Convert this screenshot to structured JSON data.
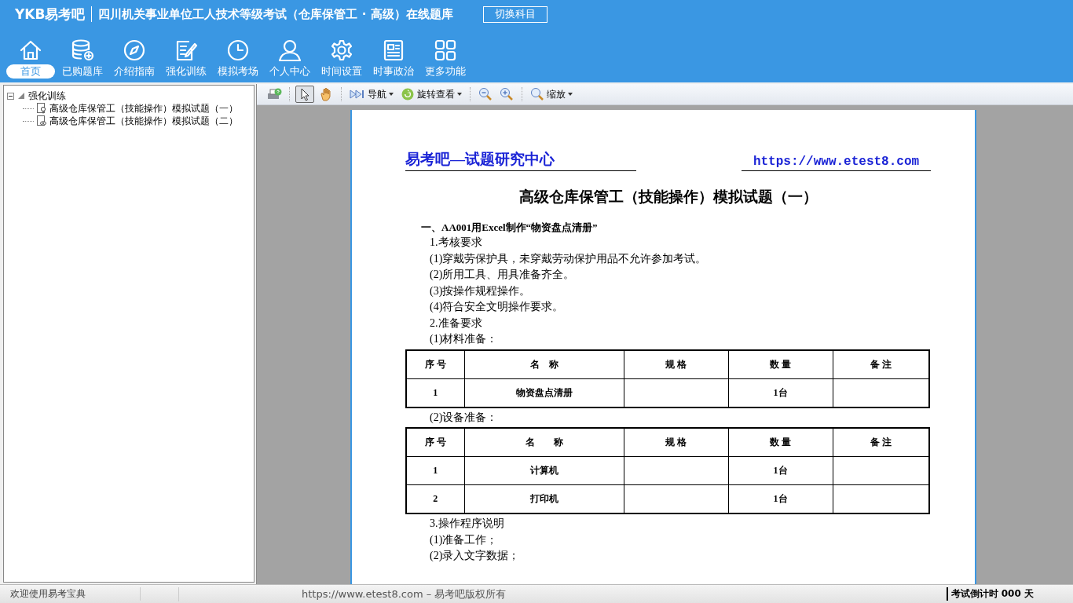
{
  "app": {
    "logo": "YKB易考吧",
    "title": "四川机关事业单位工人技术等级考试（仓库保管工 · 高级）在线题库",
    "switch_button": "切换科目"
  },
  "nav": [
    {
      "label": "首页",
      "selected": true
    },
    {
      "label": "已购题库",
      "selected": false
    },
    {
      "label": "介绍指南",
      "selected": false
    },
    {
      "label": "强化训练",
      "selected": false
    },
    {
      "label": "模拟考场",
      "selected": false
    },
    {
      "label": "个人中心",
      "selected": false
    },
    {
      "label": "时间设置",
      "selected": false
    },
    {
      "label": "时事政治",
      "selected": false
    },
    {
      "label": "更多功能",
      "selected": false
    }
  ],
  "tree": {
    "label": "强化训练",
    "expanded": true,
    "children": [
      {
        "label": "高级仓库保管工（技能操作）模拟试题（一）"
      },
      {
        "label": "高级仓库保管工（技能操作）模拟试题（二）"
      }
    ]
  },
  "toolbar": [
    {
      "kind": "icon"
    },
    {
      "kind": "separator"
    },
    {
      "kind": "icon",
      "selected": true
    },
    {
      "kind": "icon",
      "selected": false
    },
    {
      "kind": "separator"
    },
    {
      "kind": "menu",
      "label": "导航"
    },
    {
      "kind": "menu",
      "label": "旋转查看"
    },
    {
      "kind": "separator"
    },
    {
      "kind": "icon"
    },
    {
      "kind": "icon"
    },
    {
      "kind": "separator"
    },
    {
      "kind": "menu",
      "label": "缩放"
    }
  ],
  "document": {
    "header_left": "易考吧—试题研究中心",
    "header_right": "https://www.etest8.com",
    "title": "高级仓库保管工（技能操作）模拟试题（一）",
    "blocks": [
      {
        "kind": "heading",
        "text": "一、AA001用Excel制作“物资盘点清册”"
      },
      {
        "kind": "line",
        "text": "1.考核要求"
      },
      {
        "kind": "line",
        "text": "(1)穿戴劳保护具，未穿戴劳动保护用品不允许参加考试。"
      },
      {
        "kind": "line",
        "text": "(2)所用工具、用具准备齐全。"
      },
      {
        "kind": "line",
        "text": "(3)按操作规程操作。"
      },
      {
        "kind": "line",
        "text": "(4)符合安全文明操作要求。"
      },
      {
        "kind": "line",
        "text": "2.准备要求"
      },
      {
        "kind": "line",
        "text": "(1)材料准备："
      },
      {
        "kind": "table",
        "columns": [
          "序 号",
          "名　称",
          "规 格",
          "数 量",
          "备 注"
        ],
        "rows": [
          [
            "1",
            "物资盘点清册",
            "",
            "1台",
            ""
          ]
        ]
      },
      {
        "kind": "line",
        "text": "(2)设备准备："
      },
      {
        "kind": "table",
        "columns": [
          "序 号",
          "名　　称",
          "规 格",
          "数 量",
          "备 注"
        ],
        "rows": [
          [
            "1",
            "计算机",
            "",
            "1台",
            ""
          ],
          [
            "2",
            "打印机",
            "",
            "1台",
            ""
          ]
        ]
      },
      {
        "kind": "line",
        "text": "3.操作程序说明"
      },
      {
        "kind": "line",
        "text": "(1)准备工作；"
      },
      {
        "kind": "line",
        "text": "(2)录入文字数据；"
      }
    ]
  },
  "status_bar": {
    "welcome": "欢迎使用易考宝典",
    "copyright": "https://www.etest8.com – 易考吧版权所有",
    "countdown": "考试倒计时 000 天"
  }
}
